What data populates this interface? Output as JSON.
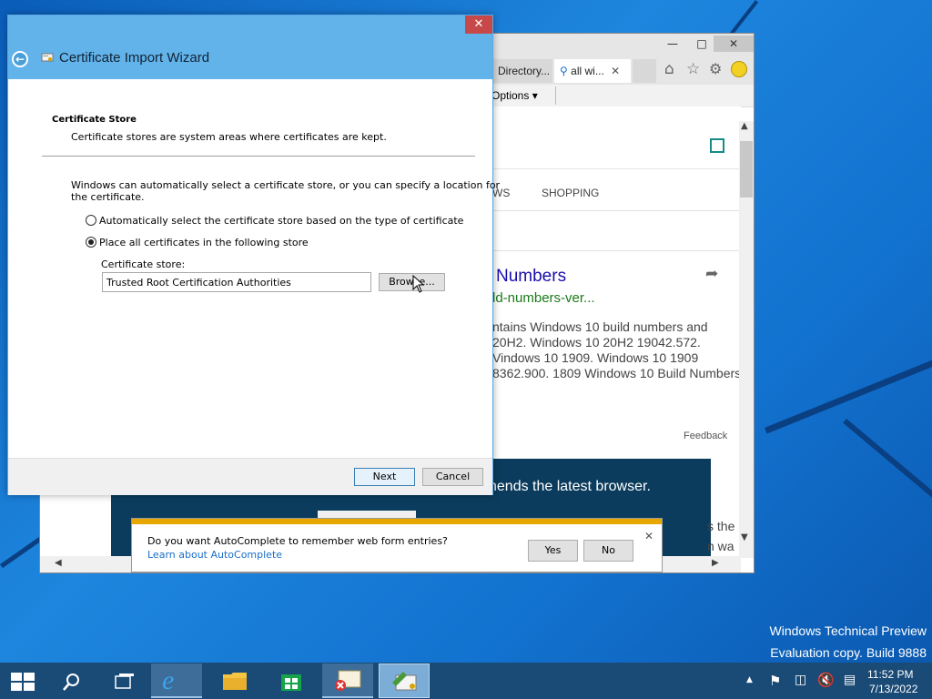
{
  "desktop": {
    "watermark_line1": "Windows Technical Preview",
    "watermark_line2": "Evaluation copy. Build 9888"
  },
  "ie": {
    "tabs": [
      {
        "label": "Directory..."
      },
      {
        "label": "all wi..."
      }
    ],
    "menu_options": "Options",
    "content": {
      "nav_fragment": "WS",
      "nav_shopping": "SHOPPING",
      "result_title_fragment": "Numbers",
      "result_url_fragment": "ld-numbers-ver...",
      "snippet_line1": "ntains Windows 10 build numbers and",
      "snippet_line2": "20H2. Windows 10 20H2 19042.572.",
      "snippet_line3": "Vindows 10 1909. Windows 10 1909",
      "snippet_line4": "8362.900. 1809 Windows 10 Build Numbers",
      "feedback": "Feedback",
      "banner_text": "nends the latest browser.",
      "side_text1": "s the",
      "side_text2": "n wa"
    }
  },
  "wizard": {
    "title": "Certificate Import Wizard",
    "section_title": "Certificate Store",
    "section_desc": "Certificate stores are system areas where certificates are kept.",
    "intro_line1": "Windows can automatically select a certificate store, or you can specify a location for",
    "intro_line2": "the certificate.",
    "option_auto": "Automatically select the certificate store based on the type of certificate",
    "option_place": "Place all certificates in the following store",
    "selected_option": "place",
    "store_label": "Certificate store:",
    "store_value": "Trusted Root Certification Authorities",
    "browse_label": "Browse...",
    "next_label": "Next",
    "cancel_label": "Cancel"
  },
  "autocomplete": {
    "question": "Do you want AutoComplete to remember web form entries?",
    "link": "Learn about AutoComplete",
    "yes_label": "Yes",
    "no_label": "No"
  },
  "taskbar": {
    "time": "11:52 PM",
    "date": "7/13/2022"
  },
  "colors": {
    "wizard_header": "#62b3ea",
    "taskbar": "#1a4a76",
    "ie_green_url": "#1a7a1a",
    "ie_link": "#1a0dab",
    "autocomplete_accent": "#e8a600",
    "banner": "#0b3c5d"
  }
}
